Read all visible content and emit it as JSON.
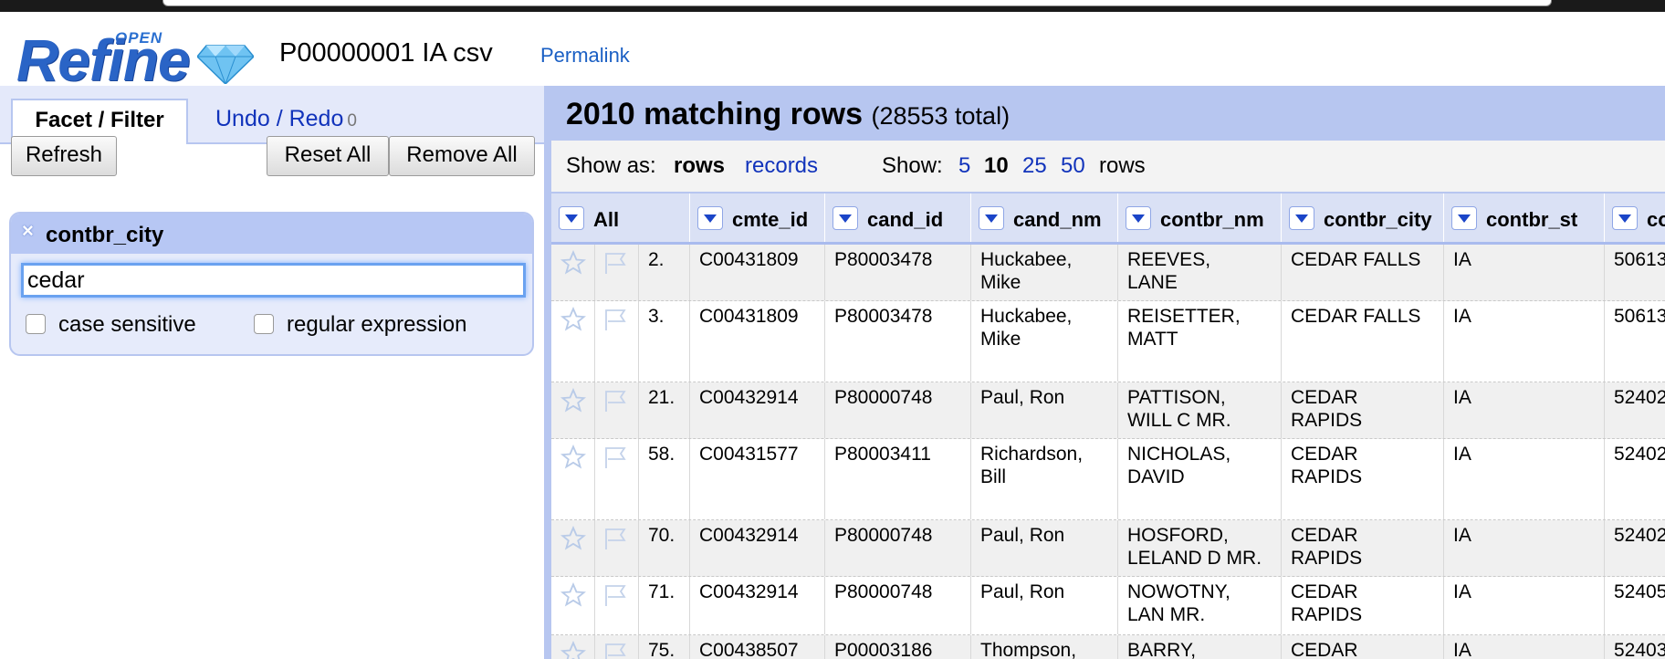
{
  "app": {
    "logo_open": "OPEN",
    "logo_refine": "Refine"
  },
  "project": {
    "title": "P00000001 IA csv",
    "permalink": "Permalink"
  },
  "left_panel": {
    "tabs": {
      "facet_filter": "Facet / Filter",
      "undo_redo": "Undo / Redo",
      "undo_count": "0"
    },
    "buttons": {
      "refresh": "Refresh",
      "reset_all": "Reset All",
      "remove_all": "Remove All"
    },
    "facet": {
      "close": "×",
      "title": "contbr_city",
      "value": "cedar",
      "case_sensitive": "case sensitive",
      "regular_expression": "regular expression"
    }
  },
  "summary": {
    "matching": "2010 matching rows",
    "total": "(28553 total)"
  },
  "toolbar": {
    "show_as": "Show as:",
    "rows": "rows",
    "records": "records",
    "show": "Show:",
    "sizes": [
      "5",
      "10",
      "25",
      "50"
    ],
    "active_size": "10",
    "rows_suffix": "rows"
  },
  "columns": [
    "All",
    "cmte_id",
    "cand_id",
    "cand_nm",
    "contbr_nm",
    "contbr_city",
    "contbr_st",
    "co"
  ],
  "rows": [
    {
      "index": "2.",
      "cmte_id": "C00431809",
      "cand_id": "P80003478",
      "cand_nm": "Huckabee,\nMike",
      "contbr_nm": "REEVES,\nLANE",
      "contbr_city": "CEDAR FALLS",
      "contbr_st": "IA",
      "zip": "50613"
    },
    {
      "index": "3.",
      "cmte_id": "C00431809",
      "cand_id": "P80003478",
      "cand_nm": "Huckabee,\nMike",
      "contbr_nm": "REISETTER,\nMATT",
      "contbr_city": "CEDAR FALLS",
      "contbr_st": "IA",
      "zip": "50613"
    },
    {
      "index": "21.",
      "cmte_id": "C00432914",
      "cand_id": "P80000748",
      "cand_nm": "Paul, Ron",
      "contbr_nm": "PATTISON,\nWILL C MR.",
      "contbr_city": "CEDAR\nRAPIDS",
      "contbr_st": "IA",
      "zip": "52402"
    },
    {
      "index": "58.",
      "cmte_id": "C00431577",
      "cand_id": "P80003411",
      "cand_nm": "Richardson,\nBill",
      "contbr_nm": "NICHOLAS,\nDAVID",
      "contbr_city": "CEDAR\nRAPIDS",
      "contbr_st": "IA",
      "zip": "52402"
    },
    {
      "index": "70.",
      "cmte_id": "C00432914",
      "cand_id": "P80000748",
      "cand_nm": "Paul, Ron",
      "contbr_nm": "HOSFORD,\nLELAND D MR.",
      "contbr_city": "CEDAR\nRAPIDS",
      "contbr_st": "IA",
      "zip": "52402"
    },
    {
      "index": "71.",
      "cmte_id": "C00432914",
      "cand_id": "P80000748",
      "cand_nm": "Paul, Ron",
      "contbr_nm": "NOWOTNY,\nLAN MR.",
      "contbr_city": "CEDAR\nRAPIDS",
      "contbr_st": "IA",
      "zip": "52405"
    },
    {
      "index": "75.",
      "cmte_id": "C00438507",
      "cand_id": "P00003186",
      "cand_nm": "Thompson,",
      "contbr_nm": "BARRY,",
      "contbr_city": "CEDAR",
      "contbr_st": "IA",
      "zip": "52403"
    }
  ],
  "colors": {
    "accent": "#1133bb",
    "panel": "#b7c6f0",
    "header": "#dae1f5"
  }
}
